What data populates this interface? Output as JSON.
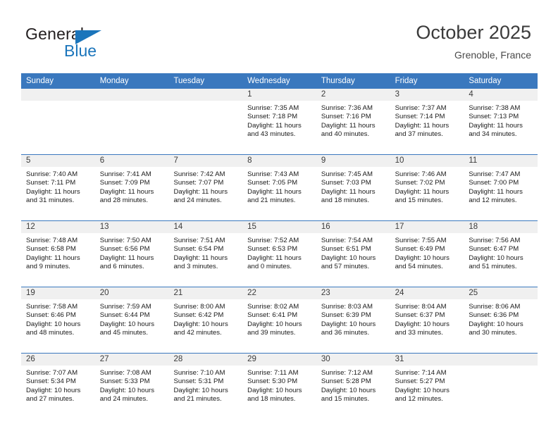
{
  "brand": {
    "name_top": "General",
    "name_bottom": "Blue",
    "accent_color": "#1b75bb"
  },
  "header": {
    "title": "October 2025",
    "location": "Grenoble, France"
  },
  "calendar": {
    "header_color": "#3a78be",
    "day_band_color": "#f0f0f0",
    "weekday_names": [
      "Sunday",
      "Monday",
      "Tuesday",
      "Wednesday",
      "Thursday",
      "Friday",
      "Saturday"
    ],
    "weeks": [
      [
        {
          "day": "",
          "empty": true
        },
        {
          "day": "",
          "empty": true
        },
        {
          "day": "",
          "empty": true
        },
        {
          "day": "1",
          "sunrise": "Sunrise: 7:35 AM",
          "sunset": "Sunset: 7:18 PM",
          "daylight_1": "Daylight: 11 hours",
          "daylight_2": "and 43 minutes."
        },
        {
          "day": "2",
          "sunrise": "Sunrise: 7:36 AM",
          "sunset": "Sunset: 7:16 PM",
          "daylight_1": "Daylight: 11 hours",
          "daylight_2": "and 40 minutes."
        },
        {
          "day": "3",
          "sunrise": "Sunrise: 7:37 AM",
          "sunset": "Sunset: 7:14 PM",
          "daylight_1": "Daylight: 11 hours",
          "daylight_2": "and 37 minutes."
        },
        {
          "day": "4",
          "sunrise": "Sunrise: 7:38 AM",
          "sunset": "Sunset: 7:13 PM",
          "daylight_1": "Daylight: 11 hours",
          "daylight_2": "and 34 minutes."
        }
      ],
      [
        {
          "day": "5",
          "sunrise": "Sunrise: 7:40 AM",
          "sunset": "Sunset: 7:11 PM",
          "daylight_1": "Daylight: 11 hours",
          "daylight_2": "and 31 minutes."
        },
        {
          "day": "6",
          "sunrise": "Sunrise: 7:41 AM",
          "sunset": "Sunset: 7:09 PM",
          "daylight_1": "Daylight: 11 hours",
          "daylight_2": "and 28 minutes."
        },
        {
          "day": "7",
          "sunrise": "Sunrise: 7:42 AM",
          "sunset": "Sunset: 7:07 PM",
          "daylight_1": "Daylight: 11 hours",
          "daylight_2": "and 24 minutes."
        },
        {
          "day": "8",
          "sunrise": "Sunrise: 7:43 AM",
          "sunset": "Sunset: 7:05 PM",
          "daylight_1": "Daylight: 11 hours",
          "daylight_2": "and 21 minutes."
        },
        {
          "day": "9",
          "sunrise": "Sunrise: 7:45 AM",
          "sunset": "Sunset: 7:03 PM",
          "daylight_1": "Daylight: 11 hours",
          "daylight_2": "and 18 minutes."
        },
        {
          "day": "10",
          "sunrise": "Sunrise: 7:46 AM",
          "sunset": "Sunset: 7:02 PM",
          "daylight_1": "Daylight: 11 hours",
          "daylight_2": "and 15 minutes."
        },
        {
          "day": "11",
          "sunrise": "Sunrise: 7:47 AM",
          "sunset": "Sunset: 7:00 PM",
          "daylight_1": "Daylight: 11 hours",
          "daylight_2": "and 12 minutes."
        }
      ],
      [
        {
          "day": "12",
          "sunrise": "Sunrise: 7:48 AM",
          "sunset": "Sunset: 6:58 PM",
          "daylight_1": "Daylight: 11 hours",
          "daylight_2": "and 9 minutes."
        },
        {
          "day": "13",
          "sunrise": "Sunrise: 7:50 AM",
          "sunset": "Sunset: 6:56 PM",
          "daylight_1": "Daylight: 11 hours",
          "daylight_2": "and 6 minutes."
        },
        {
          "day": "14",
          "sunrise": "Sunrise: 7:51 AM",
          "sunset": "Sunset: 6:54 PM",
          "daylight_1": "Daylight: 11 hours",
          "daylight_2": "and 3 minutes."
        },
        {
          "day": "15",
          "sunrise": "Sunrise: 7:52 AM",
          "sunset": "Sunset: 6:53 PM",
          "daylight_1": "Daylight: 11 hours",
          "daylight_2": "and 0 minutes."
        },
        {
          "day": "16",
          "sunrise": "Sunrise: 7:54 AM",
          "sunset": "Sunset: 6:51 PM",
          "daylight_1": "Daylight: 10 hours",
          "daylight_2": "and 57 minutes."
        },
        {
          "day": "17",
          "sunrise": "Sunrise: 7:55 AM",
          "sunset": "Sunset: 6:49 PM",
          "daylight_1": "Daylight: 10 hours",
          "daylight_2": "and 54 minutes."
        },
        {
          "day": "18",
          "sunrise": "Sunrise: 7:56 AM",
          "sunset": "Sunset: 6:47 PM",
          "daylight_1": "Daylight: 10 hours",
          "daylight_2": "and 51 minutes."
        }
      ],
      [
        {
          "day": "19",
          "sunrise": "Sunrise: 7:58 AM",
          "sunset": "Sunset: 6:46 PM",
          "daylight_1": "Daylight: 10 hours",
          "daylight_2": "and 48 minutes."
        },
        {
          "day": "20",
          "sunrise": "Sunrise: 7:59 AM",
          "sunset": "Sunset: 6:44 PM",
          "daylight_1": "Daylight: 10 hours",
          "daylight_2": "and 45 minutes."
        },
        {
          "day": "21",
          "sunrise": "Sunrise: 8:00 AM",
          "sunset": "Sunset: 6:42 PM",
          "daylight_1": "Daylight: 10 hours",
          "daylight_2": "and 42 minutes."
        },
        {
          "day": "22",
          "sunrise": "Sunrise: 8:02 AM",
          "sunset": "Sunset: 6:41 PM",
          "daylight_1": "Daylight: 10 hours",
          "daylight_2": "and 39 minutes."
        },
        {
          "day": "23",
          "sunrise": "Sunrise: 8:03 AM",
          "sunset": "Sunset: 6:39 PM",
          "daylight_1": "Daylight: 10 hours",
          "daylight_2": "and 36 minutes."
        },
        {
          "day": "24",
          "sunrise": "Sunrise: 8:04 AM",
          "sunset": "Sunset: 6:37 PM",
          "daylight_1": "Daylight: 10 hours",
          "daylight_2": "and 33 minutes."
        },
        {
          "day": "25",
          "sunrise": "Sunrise: 8:06 AM",
          "sunset": "Sunset: 6:36 PM",
          "daylight_1": "Daylight: 10 hours",
          "daylight_2": "and 30 minutes."
        }
      ],
      [
        {
          "day": "26",
          "sunrise": "Sunrise: 7:07 AM",
          "sunset": "Sunset: 5:34 PM",
          "daylight_1": "Daylight: 10 hours",
          "daylight_2": "and 27 minutes."
        },
        {
          "day": "27",
          "sunrise": "Sunrise: 7:08 AM",
          "sunset": "Sunset: 5:33 PM",
          "daylight_1": "Daylight: 10 hours",
          "daylight_2": "and 24 minutes."
        },
        {
          "day": "28",
          "sunrise": "Sunrise: 7:10 AM",
          "sunset": "Sunset: 5:31 PM",
          "daylight_1": "Daylight: 10 hours",
          "daylight_2": "and 21 minutes."
        },
        {
          "day": "29",
          "sunrise": "Sunrise: 7:11 AM",
          "sunset": "Sunset: 5:30 PM",
          "daylight_1": "Daylight: 10 hours",
          "daylight_2": "and 18 minutes."
        },
        {
          "day": "30",
          "sunrise": "Sunrise: 7:12 AM",
          "sunset": "Sunset: 5:28 PM",
          "daylight_1": "Daylight: 10 hours",
          "daylight_2": "and 15 minutes."
        },
        {
          "day": "31",
          "sunrise": "Sunrise: 7:14 AM",
          "sunset": "Sunset: 5:27 PM",
          "daylight_1": "Daylight: 10 hours",
          "daylight_2": "and 12 minutes."
        },
        {
          "day": "",
          "empty": true
        }
      ]
    ]
  }
}
